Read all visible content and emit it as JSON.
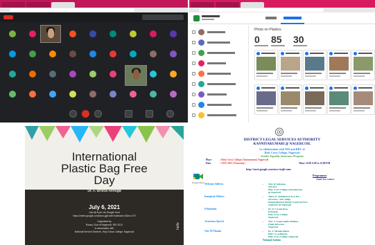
{
  "meeting": {
    "avatar_colors": [
      "#7cb342",
      "#e91e63",
      "#8e24aa",
      "#f4511e",
      "#3949ab",
      "#00897b",
      "#c0ca33",
      "#d81b60",
      "#5e35b1",
      "#039be5",
      "#43a047",
      "#fb8c00",
      "#6d4c41",
      "#1e88e5",
      "#e53935",
      "#00acc1",
      "#8d6e63",
      "#7e57c2",
      "#26a69a",
      "#ef6c00",
      "#546e7a",
      "#ab47bc",
      "#9ccc65",
      "#ec407a",
      "#5c6bc0",
      "#26c6da",
      "#ffa726",
      "#66bb6a",
      "#ff7043",
      "#42a5f5",
      "#d4e157",
      "#8d6e63",
      "#7986cb",
      "#f06292",
      "#4db6ac",
      "#ba68c8"
    ]
  },
  "classroom": {
    "panel_title": "Photo on Plastics",
    "stats": [
      "0",
      "85",
      "30"
    ]
  },
  "poster": {
    "title_line1": "International",
    "title_line2": "Plastic Bag Free",
    "title_line3": "Day",
    "speaker": "Dr. F. Brisca Renuga",
    "date": "July 6, 2021",
    "join_text": "Join @ 8 pm via Google meet",
    "link": "https://meet.google.com/kwm-pjpf-bdb?authuser=0&hs=179",
    "organised_by": "Organised by",
    "org_1": "Rotary Club of Nagercoil, RID 3212",
    "collab": "in association with",
    "org_2": "National Service Scheme, Holy Cross College, Nagercoil",
    "side_text": "hello"
  },
  "notice": {
    "h1": "DISTRICT LEGAL SERVICES AUTHORITY",
    "h2": "KANNIYAKUMARI @ NAGERCOIL",
    "h3": "in collaboration with NSS and RRC of",
    "h4": "Holy Cross College, Nagercoil",
    "h5": "Gender Equality Awareness Program",
    "place_label": "Place",
    "place_value": ": Holy Cross College (Autonomous) Nagercoil",
    "date_label": "Date",
    "date_value": ": 29.07.2021 (Thursday)",
    "time_value": "Time: 11.00 A.M to 12.00 P.M",
    "link": "http://meet.google.com/mve-imjh-ome",
    "gm_label": "Google Meet",
    "prog_title": "Programme",
    "prog_sub": "Tamil Tea Culture",
    "sections": [
      {
        "name": "Welcome Address",
        "lines": [
          "Tmt. R.Veshanta,",
          "NSS PO,",
          "Holy Cross College (Autonomous)",
          "@ Nagercoil"
        ]
      },
      {
        "name": "Inaugural Address",
        "lines": [
          "Thiru. K. Ramkumar, B.A.,B.L.,",
          "Secretary / Sub Judge,",
          "Kanniyakumari District Legal   Services",
          "Authority @ Nagercoil"
        ]
      },
      {
        "name": "Felicitation",
        "lines": [
          "Dr. Sr. Lavola Rose,",
          "Principal,",
          "Holy Cross College,",
          "Nagercoil"
        ]
      },
      {
        "name": "Awareness Speech",
        "lines": [
          "Tmt. V. Annie Sophia Hatlina,",
          "Panel Advocate,",
          "Nagercoil"
        ]
      },
      {
        "name": "Vote Of Thanks",
        "lines": [
          "Dr. T. Monika Helen,",
          "RRC Co-ordinator,",
          "Holy Cross College, Nagercoil"
        ]
      }
    ],
    "footer": "National Anthem"
  }
}
